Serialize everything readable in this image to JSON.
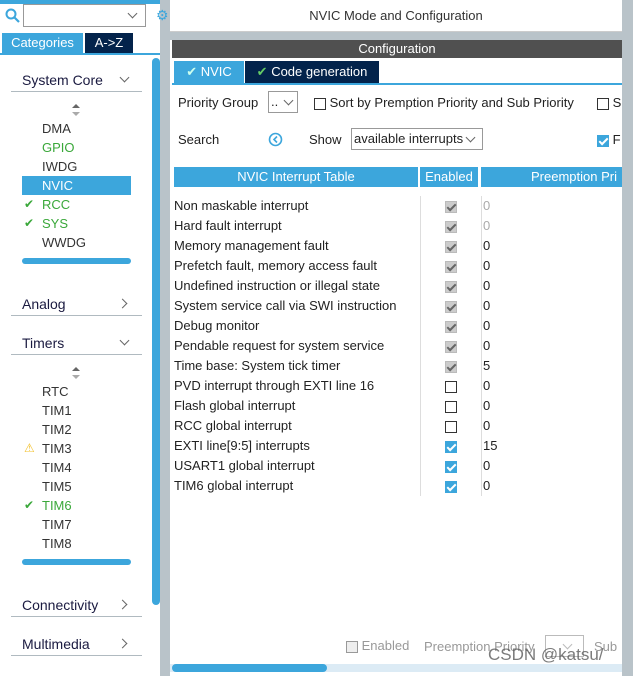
{
  "left": {
    "search": {
      "value": "",
      "icon": "search-icon"
    },
    "tabs": [
      "Categories",
      "A->Z"
    ],
    "sections": [
      {
        "label": "System Core",
        "expanded": true,
        "items": [
          {
            "label": "DMA",
            "status": ""
          },
          {
            "label": "GPIO",
            "status": "configured"
          },
          {
            "label": "IWDG",
            "status": ""
          },
          {
            "label": "NVIC",
            "status": "selected"
          },
          {
            "label": "RCC",
            "status": "ok"
          },
          {
            "label": "SYS",
            "status": "ok"
          },
          {
            "label": "WWDG",
            "status": ""
          }
        ]
      },
      {
        "label": "Analog",
        "expanded": false
      },
      {
        "label": "Timers",
        "expanded": true,
        "items": [
          {
            "label": "RTC",
            "status": ""
          },
          {
            "label": "TIM1",
            "status": ""
          },
          {
            "label": "TIM2",
            "status": ""
          },
          {
            "label": "TIM3",
            "status": "warning"
          },
          {
            "label": "TIM4",
            "status": ""
          },
          {
            "label": "TIM5",
            "status": ""
          },
          {
            "label": "TIM6",
            "status": "ok"
          },
          {
            "label": "TIM7",
            "status": ""
          },
          {
            "label": "TIM8",
            "status": ""
          }
        ]
      },
      {
        "label": "Connectivity",
        "expanded": false
      },
      {
        "label": "Multimedia",
        "expanded": false
      }
    ]
  },
  "right": {
    "title": "NVIC Mode and Configuration",
    "config_header": "Configuration",
    "tabs": [
      "NVIC",
      "Code generation"
    ],
    "priority_group_label": "Priority Group",
    "priority_group_value": "..",
    "sort_label": "Sort by Premption Priority and Sub Priority",
    "sort_checked": false,
    "extra_cb_label": "S",
    "search_label": "Search",
    "show_label": "Show",
    "show_value": "available interrupts",
    "extra_cb2_label": "F",
    "extra_cb2_checked": true,
    "columns": [
      "NVIC Interrupt Table",
      "Enabled",
      "Preemption Pri"
    ],
    "rows": [
      {
        "name": "Non maskable interrupt",
        "enabled": true,
        "locked": true,
        "priority": "0"
      },
      {
        "name": "Hard fault interrupt",
        "enabled": true,
        "locked": true,
        "priority": "0"
      },
      {
        "name": "Memory management fault",
        "enabled": true,
        "locked": true,
        "priority": "0"
      },
      {
        "name": "Prefetch fault, memory access fault",
        "enabled": true,
        "locked": true,
        "priority": "0"
      },
      {
        "name": "Undefined instruction or illegal state",
        "enabled": true,
        "locked": true,
        "priority": "0"
      },
      {
        "name": "System service call via SWI instruction",
        "enabled": true,
        "locked": true,
        "priority": "0"
      },
      {
        "name": "Debug monitor",
        "enabled": true,
        "locked": true,
        "priority": "0"
      },
      {
        "name": "Pendable request for system service",
        "enabled": true,
        "locked": true,
        "priority": "0"
      },
      {
        "name": "Time base: System tick timer",
        "enabled": true,
        "locked": true,
        "priority": "5"
      },
      {
        "name": "PVD interrupt through EXTI line 16",
        "enabled": false,
        "locked": false,
        "priority": "0"
      },
      {
        "name": "Flash global interrupt",
        "enabled": false,
        "locked": false,
        "priority": "0"
      },
      {
        "name": "RCC global interrupt",
        "enabled": false,
        "locked": false,
        "priority": "0"
      },
      {
        "name": "EXTI line[9:5] interrupts",
        "enabled": true,
        "locked": false,
        "priority": "15"
      },
      {
        "name": "USART1 global interrupt",
        "enabled": true,
        "locked": false,
        "priority": "0"
      },
      {
        "name": "TIM6 global interrupt",
        "enabled": true,
        "locked": false,
        "priority": "0"
      }
    ],
    "footer": {
      "enabled_label": "Enabled",
      "preemption_label": "Preemption Priority",
      "sub_label": "Sub"
    },
    "watermark": "CSDN @katsu/"
  },
  "colors": {
    "accent": "#3ca6dc",
    "dark_tab": "#03234b",
    "header": "#505050",
    "ok": "#3aa83a",
    "warning": "#f2c12e"
  }
}
